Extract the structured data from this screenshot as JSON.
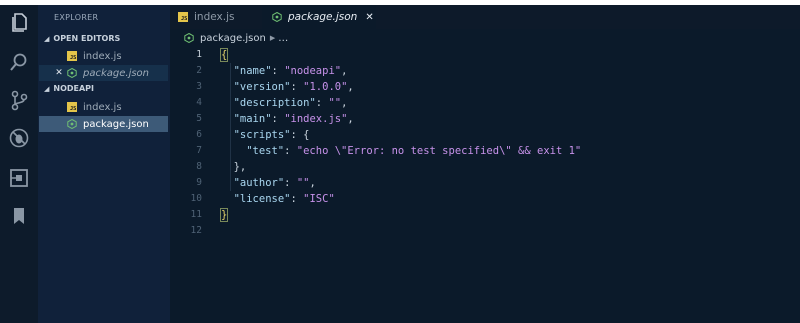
{
  "colors": {
    "editor_bg": "#0b1a2a",
    "sidebar_bg": "#10213a",
    "active_item": "#3d5a78",
    "string": "#c792ea",
    "key": "#a9d6ef",
    "js_icon": "#e4c54a",
    "json_icon": "#6fbf73"
  },
  "activity_bar": {
    "icons": [
      "files-icon",
      "search-icon",
      "source-control-icon",
      "debug-icon",
      "extensions-icon",
      "bookmark-icon"
    ]
  },
  "sidebar": {
    "title": "EXPLORER",
    "open_editors": {
      "label": "OPEN EDITORS",
      "items": [
        {
          "label": "index.js",
          "icon": "js-icon"
        },
        {
          "label": "package.json",
          "icon": "json-icon",
          "close": "✕"
        }
      ]
    },
    "project": {
      "label": "NODEAPI",
      "items": [
        {
          "label": "index.js",
          "icon": "js-icon"
        },
        {
          "label": "package.json",
          "icon": "json-icon"
        }
      ]
    }
  },
  "tabs": [
    {
      "label": "index.js",
      "icon": "js-icon"
    },
    {
      "label": "package.json",
      "icon": "json-icon",
      "close": "✕"
    }
  ],
  "breadcrumb": {
    "file": "package.json",
    "more": "…"
  },
  "editor": {
    "lines": [
      {
        "n": "1",
        "code": "{"
      },
      {
        "n": "2",
        "key": "\"name\"",
        "val": "\"nodeapi\"",
        "end": ","
      },
      {
        "n": "3",
        "key": "\"version\"",
        "val": "\"1.0.0\"",
        "end": ","
      },
      {
        "n": "4",
        "key": "\"description\"",
        "val": "\"\"",
        "end": ","
      },
      {
        "n": "5",
        "key": "\"main\"",
        "val": "\"index.js\"",
        "end": ","
      },
      {
        "n": "6",
        "key": "\"scripts\"",
        "val": "",
        "end": "{"
      },
      {
        "n": "7",
        "key": "\"test\"",
        "val": "\"echo \\\"Error: no test specified\\\" && exit 1\"",
        "end": ""
      },
      {
        "n": "8",
        "code": "},"
      },
      {
        "n": "9",
        "key": "\"author\"",
        "val": "\"\"",
        "end": ","
      },
      {
        "n": "10",
        "key": "\"license\"",
        "val": "\"ISC\"",
        "end": ""
      },
      {
        "n": "11",
        "code": "}"
      },
      {
        "n": "12",
        "code": ""
      }
    ],
    "current_line": "1"
  }
}
